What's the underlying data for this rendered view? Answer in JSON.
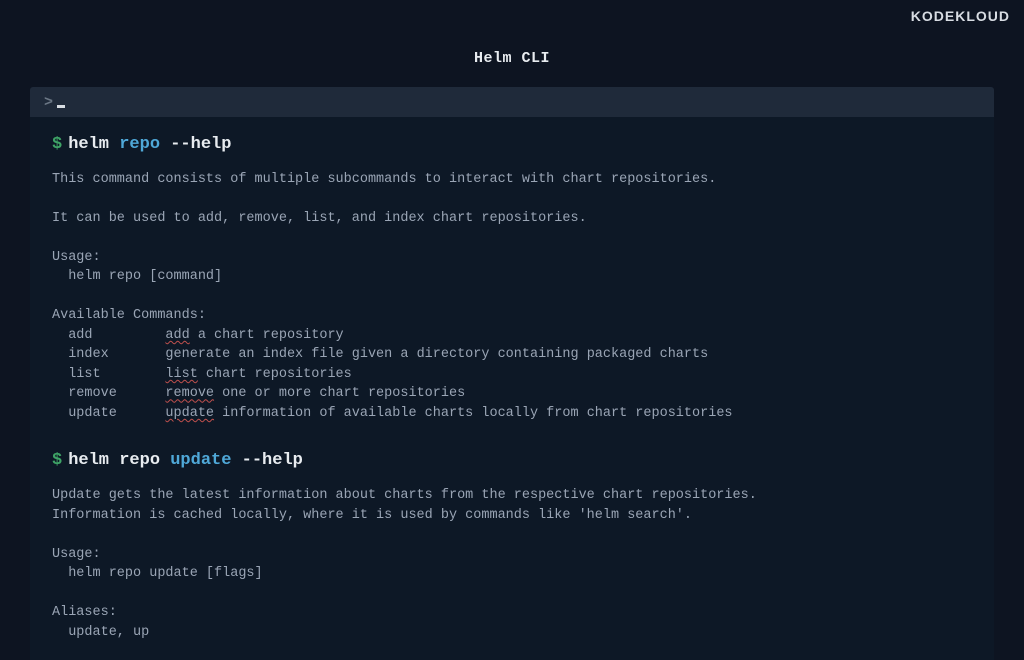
{
  "logo": {
    "part1": "KODE",
    "part2": "K",
    "part3": "LOUD"
  },
  "title": "Helm CLI",
  "tab": {
    "prompt": ">"
  },
  "block1": {
    "dollar": "$",
    "cmd_prefix": "helm ",
    "cmd_highlight": "repo",
    "cmd_suffix": " --help",
    "line1": "This command consists of multiple subcommands to interact with chart repositories.",
    "line2": "It can be used to add, remove, list, and index chart repositories.",
    "usage_label": "Usage:",
    "usage_cmd": "  helm repo [command]",
    "avail_label": "Available Commands:",
    "cmds": {
      "add_name": "  add         ",
      "add_hl": "add",
      "add_rest": " a chart repository",
      "index_name": "  index       ",
      "index_rest": "generate an index file given a directory containing packaged charts",
      "list_name": "  list        ",
      "list_hl": "list",
      "list_rest": " chart repositories",
      "remove_name": "  remove      ",
      "remove_hl": "remove",
      "remove_rest": " one or more chart repositories",
      "update_name": "  update      ",
      "update_hl": "update",
      "update_rest": " information of available charts locally from chart repositories"
    }
  },
  "block2": {
    "dollar": "$",
    "cmd_prefix": "helm repo ",
    "cmd_highlight": "update",
    "cmd_suffix": " --help",
    "line1": "Update gets the latest information about charts from the respective chart repositories.",
    "line2": "Information is cached locally, where it is used by commands like 'helm search'.",
    "usage_label": "Usage:",
    "usage_cmd": "  helm repo update [flags]",
    "aliases_label": "Aliases:",
    "aliases": "  update, up"
  }
}
